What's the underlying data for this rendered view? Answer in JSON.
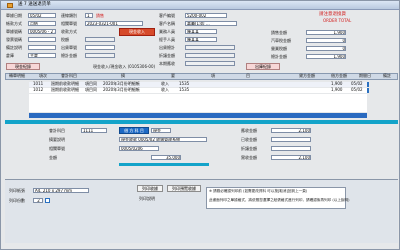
{
  "window": {
    "title": "送 7 送送退货单"
  },
  "header": {
    "doc_date_label": "單據日期",
    "doc_date": "05/02",
    "status_label": "連線類別",
    "status_value": "1",
    "status_suffix": "銷售",
    "customer_code_label": "客戶編號",
    "customer_code": "5200-002",
    "customer_name_label": "客戶名稱",
    "customer_name": "嘉義(1)店 ...",
    "payment_label": "帳款方式",
    "payment_value": "月結",
    "doc_no_label": "單據號碼",
    "doc_no": "0005/06 - 2 3",
    "collect_method_label": "收款方式",
    "collect_method_value": "現金收入",
    "sales_label": "業務人員",
    "sales_value": "陳某某",
    "handler_label": "經手人員",
    "handler_value": "陳某某",
    "invoice_label": "發票號碼",
    "invoice_value": "",
    "tax_label": "稅額",
    "ref_label": "相關單號",
    "ref_value": "2023-0321-001",
    "note_label": "備註說明",
    "note_value": "",
    "ship_label": "出貨單號",
    "ship_value": "",
    "warehouse_label": "倉庫",
    "warehouse_value": "主倉",
    "total_label": "總計金額",
    "total_value": "",
    "summary_labels": [
      "出貨總計",
      "折讓金額",
      "本期應收"
    ],
    "top_right_title": "請注意退換貨",
    "top_right_sub": "ORDER TOTAL",
    "right_fields": [
      {
        "label": "銷售金額",
        "value": "1,900"
      },
      {
        "label": "汽車稅金額",
        "value": "0"
      },
      {
        "label": "營業稅額",
        "value": "0"
      },
      {
        "label": "總計金額",
        "value": "1,900"
      }
    ]
  },
  "toolbar": {
    "left_label": "現金紀錄",
    "mid_label": "現金收入/現金收入 (0105306-00)",
    "right_label": "出庫紀錄"
  },
  "detail_header": {
    "section_label": "轉單明細",
    "columns": [
      "項次",
      "會計科目",
      "摘",
      "要",
      "項",
      "目",
      "貸方金額",
      "借方金額",
      "期間日",
      "備註"
    ]
  },
  "detail_rows": [
    {
      "no": "1011",
      "account": "過期前收款明細",
      "desc": "項目同",
      "text": "2020年3月份明細帳",
      "qty": "收入",
      "amount": "1535",
      "credit": "1,900",
      "date": "05/02"
    },
    {
      "no": "1012",
      "account": "過期前收款明細",
      "desc": "項目同",
      "text": "2020年3月份明細帳",
      "qty": "收入",
      "amount": "1535",
      "credit": "1,900",
      "date": "05/02"
    }
  ],
  "lower": {
    "account_label": "會計科目",
    "account_value": "1111",
    "account_type_label": "借 方 科 目",
    "account_type_value": "現金",
    "desc_label": "摘要說明",
    "desc_value": "現金收款 0005/02 收銀管理系統",
    "ref_label": "相關單號",
    "ref_value": "0005/0206",
    "amount_label": "金額",
    "amount_value": "35,000",
    "right": [
      {
        "label": "應收金額",
        "value": "2,100"
      },
      {
        "label": "已收金額",
        "value": ""
      },
      {
        "label": "折讓金額",
        "value": ""
      },
      {
        "label": "實收金額",
        "value": "2,100"
      }
    ]
  },
  "print": {
    "paper_label": "列印紙張",
    "paper_value": "A4, 210 x 297 mm",
    "copies_label": "列印份數",
    "copies_value": "2",
    "print_btn": "列印收據",
    "preview_btn": "列印預覽收據",
    "tip_title": "列印說明",
    "tip_text_1": "※ 請務必確認列印前 (如需更改資料 可以按[取消]回到上一頁)",
    "tip_text_2": "此畫面列印之單據格式，將依照您選擇之紙張格式進行列印，請確認後再列印 (以上說明)"
  }
}
